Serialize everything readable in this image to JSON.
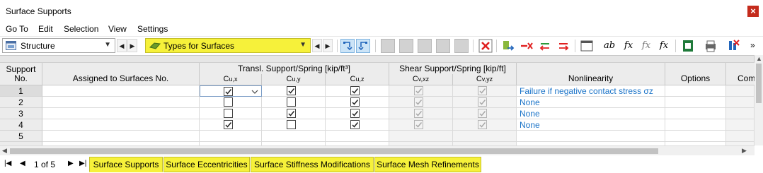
{
  "window": {
    "title": "Surface Supports",
    "close_label": "×"
  },
  "menu": [
    "Go To",
    "Edit",
    "Selection",
    "View",
    "Settings"
  ],
  "toolbar": {
    "combo1": {
      "value": "Structure"
    },
    "combo2": {
      "value": "Types for Surfaces"
    },
    "fx1": "fx",
    "fx2": "fx",
    "fx3": "fx",
    "ab": "ab",
    "more": "»"
  },
  "colors": {
    "accent_yellow": "#f6f13a",
    "link_blue": "#1a73c8",
    "delete_red": "#e02020",
    "close_red": "#c42b1c"
  },
  "table": {
    "headers": {
      "support_no": "Support No.",
      "assigned": "Assigned to Surfaces No.",
      "transl_group": "Transl. Support/Spring [kip/ft³]",
      "shear_group": "Shear Support/Spring [kip/ft]",
      "nonlinearity": "Nonlinearity",
      "options": "Options",
      "comment": "Com"
    },
    "subheaders": {
      "cux": "C",
      "cux_sub": "u,x",
      "cuy": "C",
      "cuy_sub": "u,y",
      "cuz": "C",
      "cuz_sub": "u,z",
      "cvxz": "C",
      "cvxz_sub": "v,xz",
      "cvyz": "C",
      "cvyz_sub": "v,yz"
    },
    "rows": [
      {
        "no": "1",
        "cux": true,
        "cuy": true,
        "cuz": true,
        "cvxz": true,
        "cvyz": true,
        "nonlinearity": "Failure if negative contact stress σz"
      },
      {
        "no": "2",
        "cux": false,
        "cuy": false,
        "cuz": true,
        "cvxz": true,
        "cvyz": true,
        "nonlinearity": "None"
      },
      {
        "no": "3",
        "cux": false,
        "cuy": true,
        "cuz": true,
        "cvxz": true,
        "cvyz": true,
        "nonlinearity": "None"
      },
      {
        "no": "4",
        "cux": true,
        "cuy": false,
        "cuz": true,
        "cvxz": true,
        "cvyz": true,
        "nonlinearity": "None"
      },
      {
        "no": "5"
      }
    ]
  },
  "pager": {
    "text": "1 of 5"
  },
  "tabs": [
    "Surface Supports",
    "Surface Eccentricities",
    "Surface Stiffness Modifications",
    "Surface Mesh Refinements"
  ]
}
